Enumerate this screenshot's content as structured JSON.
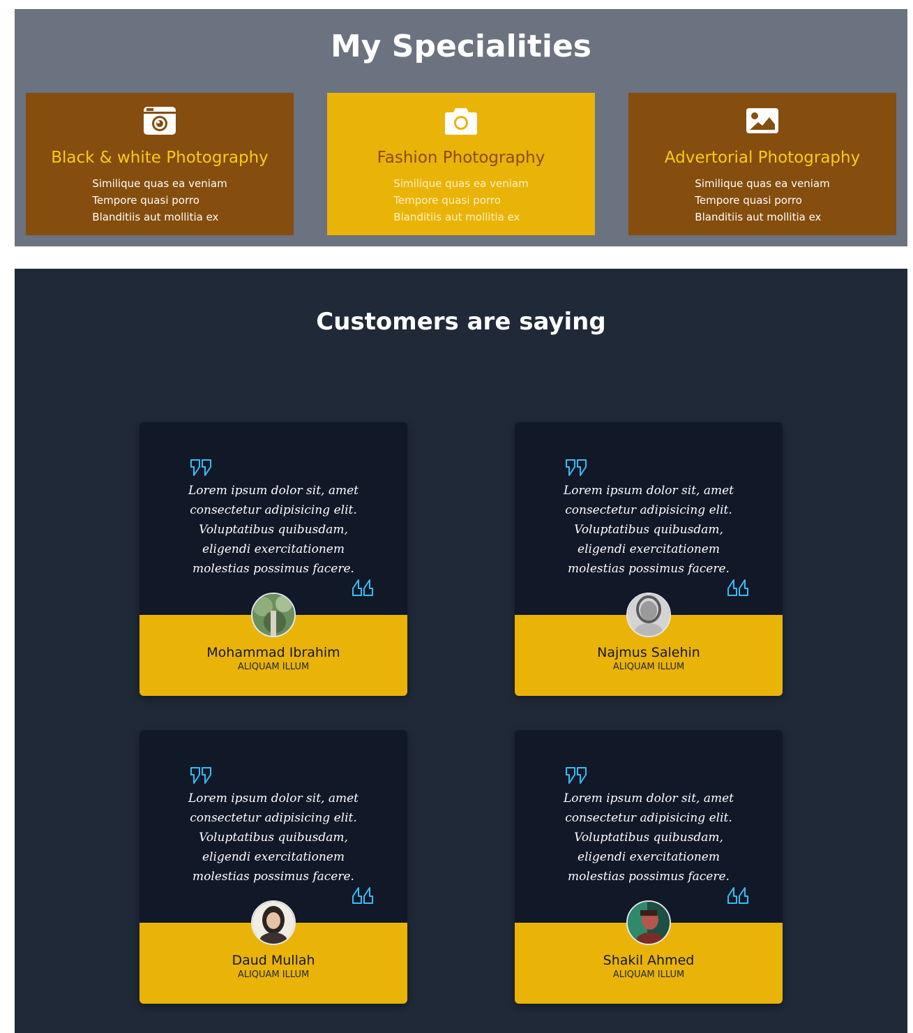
{
  "specialities": {
    "title": "My Specialities",
    "cards": [
      {
        "icon": "camera-retro-icon",
        "title": "Black & white Photography",
        "lines": [
          "Similique quas ea veniam",
          "Tempore quasi porro",
          "Blanditiis aut mollitia ex"
        ],
        "bg_color": "#854d0e"
      },
      {
        "icon": "camera-icon",
        "title": "Fashion Photography",
        "lines": [
          "Similique quas ea veniam",
          "Tempore quasi porro",
          "Blanditiis aut mollitia ex"
        ],
        "bg_color": "#eab308"
      },
      {
        "icon": "image-icon",
        "title": "Advertorial Photography",
        "lines": [
          "Similique quas ea veniam",
          "Tempore quasi porro",
          "Blanditiis aut mollitia ex"
        ],
        "bg_color": "#854d0e"
      }
    ]
  },
  "testimonials": {
    "title": "Customers are saying",
    "cards": [
      {
        "quote": "Lorem ipsum dolor sit, amet consectetur adipisicing elit. Voluptatibus quibusdam, eligendi exercitationem molestias possimus facere.",
        "name": "Mohammad Ibrahim",
        "role": "ALIQUAM ILLUM"
      },
      {
        "quote": "Lorem ipsum dolor sit, amet consectetur adipisicing elit. Voluptatibus quibusdam, eligendi exercitationem molestias possimus facere.",
        "name": "Najmus Salehin",
        "role": "ALIQUAM ILLUM"
      },
      {
        "quote": "Lorem ipsum dolor sit, amet consectetur adipisicing elit. Voluptatibus quibusdam, eligendi exercitationem molestias possimus facere.",
        "name": "Daud Mullah",
        "role": "ALIQUAM ILLUM"
      },
      {
        "quote": "Lorem ipsum dolor sit, amet consectetur adipisicing elit. Voluptatibus quibusdam, eligendi exercitationem molestias possimus facere.",
        "name": "Shakil Ahmed",
        "role": "ALIQUAM ILLUM"
      }
    ]
  },
  "colors": {
    "accent_yellow": "#eab308",
    "accent_brown": "#854d0e",
    "quote_icon": "#38bdf8",
    "dark_bg": "#1f2937",
    "card_bg": "#111827",
    "specialities_bg": "#6b7280"
  }
}
